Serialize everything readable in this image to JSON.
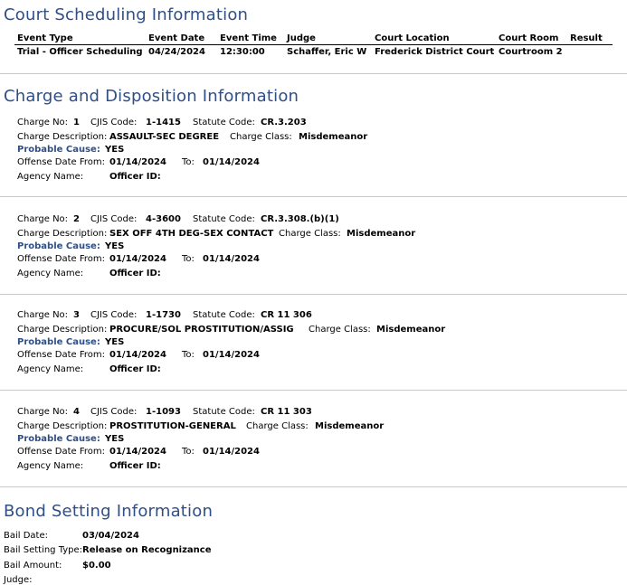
{
  "sections": {
    "court_title": "Court Scheduling Information",
    "charge_title": "Charge and Disposition Information",
    "bond_title": "Bond Setting Information"
  },
  "court": {
    "headers": [
      "Event Type",
      "Event Date",
      "Event Time",
      "Judge",
      "Court Location",
      "Court Room",
      "Result"
    ],
    "row": [
      "Trial - Officer Scheduling",
      "04/24/2024",
      "12:30:00",
      "Schaffer, Eric W",
      "Frederick District Court",
      "Courtroom 2",
      ""
    ]
  },
  "labels": {
    "charge_no": "Charge No:",
    "cjis": "CJIS Code:",
    "statute": "Statute Code:",
    "desc": "Charge Description:",
    "class": "Charge Class:",
    "probable": "Probable Cause:",
    "offense_from": "Offense Date From:",
    "to": "To:",
    "agency": "Agency Name:",
    "officer": "Officer ID:"
  },
  "charges": [
    {
      "no": "1",
      "cjis": "1-1415",
      "statute": "CR.3.203",
      "desc": "ASSAULT-SEC DEGREE",
      "class": "Misdemeanor",
      "probable": "YES",
      "from": "01/14/2024",
      "to": "01/14/2024",
      "agency": "",
      "officer": ""
    },
    {
      "no": "2",
      "cjis": "4-3600",
      "statute": "CR.3.308.(b)(1)",
      "desc": "SEX OFF 4TH DEG-SEX CONTACT",
      "class": "Misdemeanor",
      "probable": "YES",
      "from": "01/14/2024",
      "to": "01/14/2024",
      "agency": "",
      "officer": ""
    },
    {
      "no": "3",
      "cjis": "1-1730",
      "statute": "CR 11 306",
      "desc": "PROCURE/SOL PROSTITUTION/ASSIG",
      "class": "Misdemeanor",
      "probable": "YES",
      "from": "01/14/2024",
      "to": "01/14/2024",
      "agency": "",
      "officer": ""
    },
    {
      "no": "4",
      "cjis": "1-1093",
      "statute": "CR 11 303",
      "desc": "PROSTITUTION-GENERAL",
      "class": "Misdemeanor",
      "probable": "YES",
      "from": "01/14/2024",
      "to": "01/14/2024",
      "agency": "",
      "officer": ""
    }
  ],
  "bond": {
    "bail_date_label": "Bail Date:",
    "bail_date": "03/04/2024",
    "setting_type_label": "Bail Setting Type:",
    "setting_type": "Release on Recognizance",
    "amount_label": "Bail Amount:",
    "amount": "$0.00",
    "judge_label": "Judge:"
  }
}
